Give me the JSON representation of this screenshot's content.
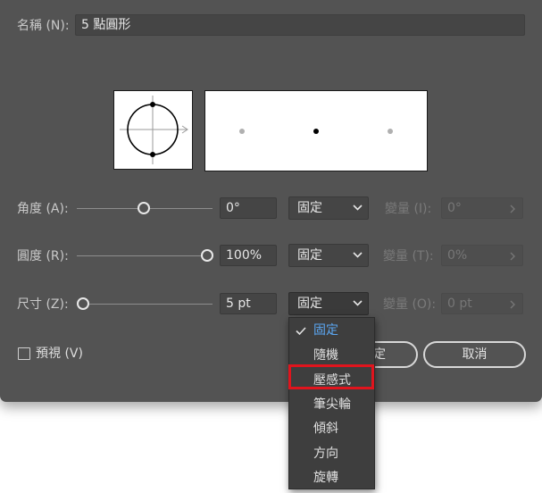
{
  "name_field": {
    "label": "名稱 (N):",
    "value": "5 點圓形"
  },
  "angle": {
    "label": "角度 (A):",
    "value": "0°",
    "slider_fraction": 0.5,
    "mode": "固定",
    "variation_label": "變量 (I):",
    "variation_value": "0°"
  },
  "roundness": {
    "label": "圓度 (R):",
    "value": "100%",
    "slider_fraction": 1.0,
    "mode": "固定",
    "variation_label": "變量 (T):",
    "variation_value": "0%"
  },
  "size": {
    "label": "尺寸 (Z):",
    "value": "5 pt",
    "slider_fraction": 0.0,
    "mode": "固定",
    "variation_label": "變量 (O):",
    "variation_value": "0 pt"
  },
  "preview_checkbox": {
    "label": "預視 (V)",
    "checked": false
  },
  "buttons": {
    "ok_partial": "定",
    "cancel": "取消"
  },
  "dropdown_menu": {
    "items": [
      "固定",
      "隨機",
      "壓感式",
      "筆尖輪",
      "傾斜",
      "方向",
      "旋轉"
    ],
    "selected": "固定",
    "highlighted": "壓感式"
  },
  "colors": {
    "dialog_bg": "#535353",
    "selected_item": "#5ba7f3",
    "highlight_border": "#e0141d"
  },
  "icons": [
    "chevron-down-icon",
    "chevron-right-icon",
    "checkmark-icon",
    "slider-knob-icon"
  ]
}
